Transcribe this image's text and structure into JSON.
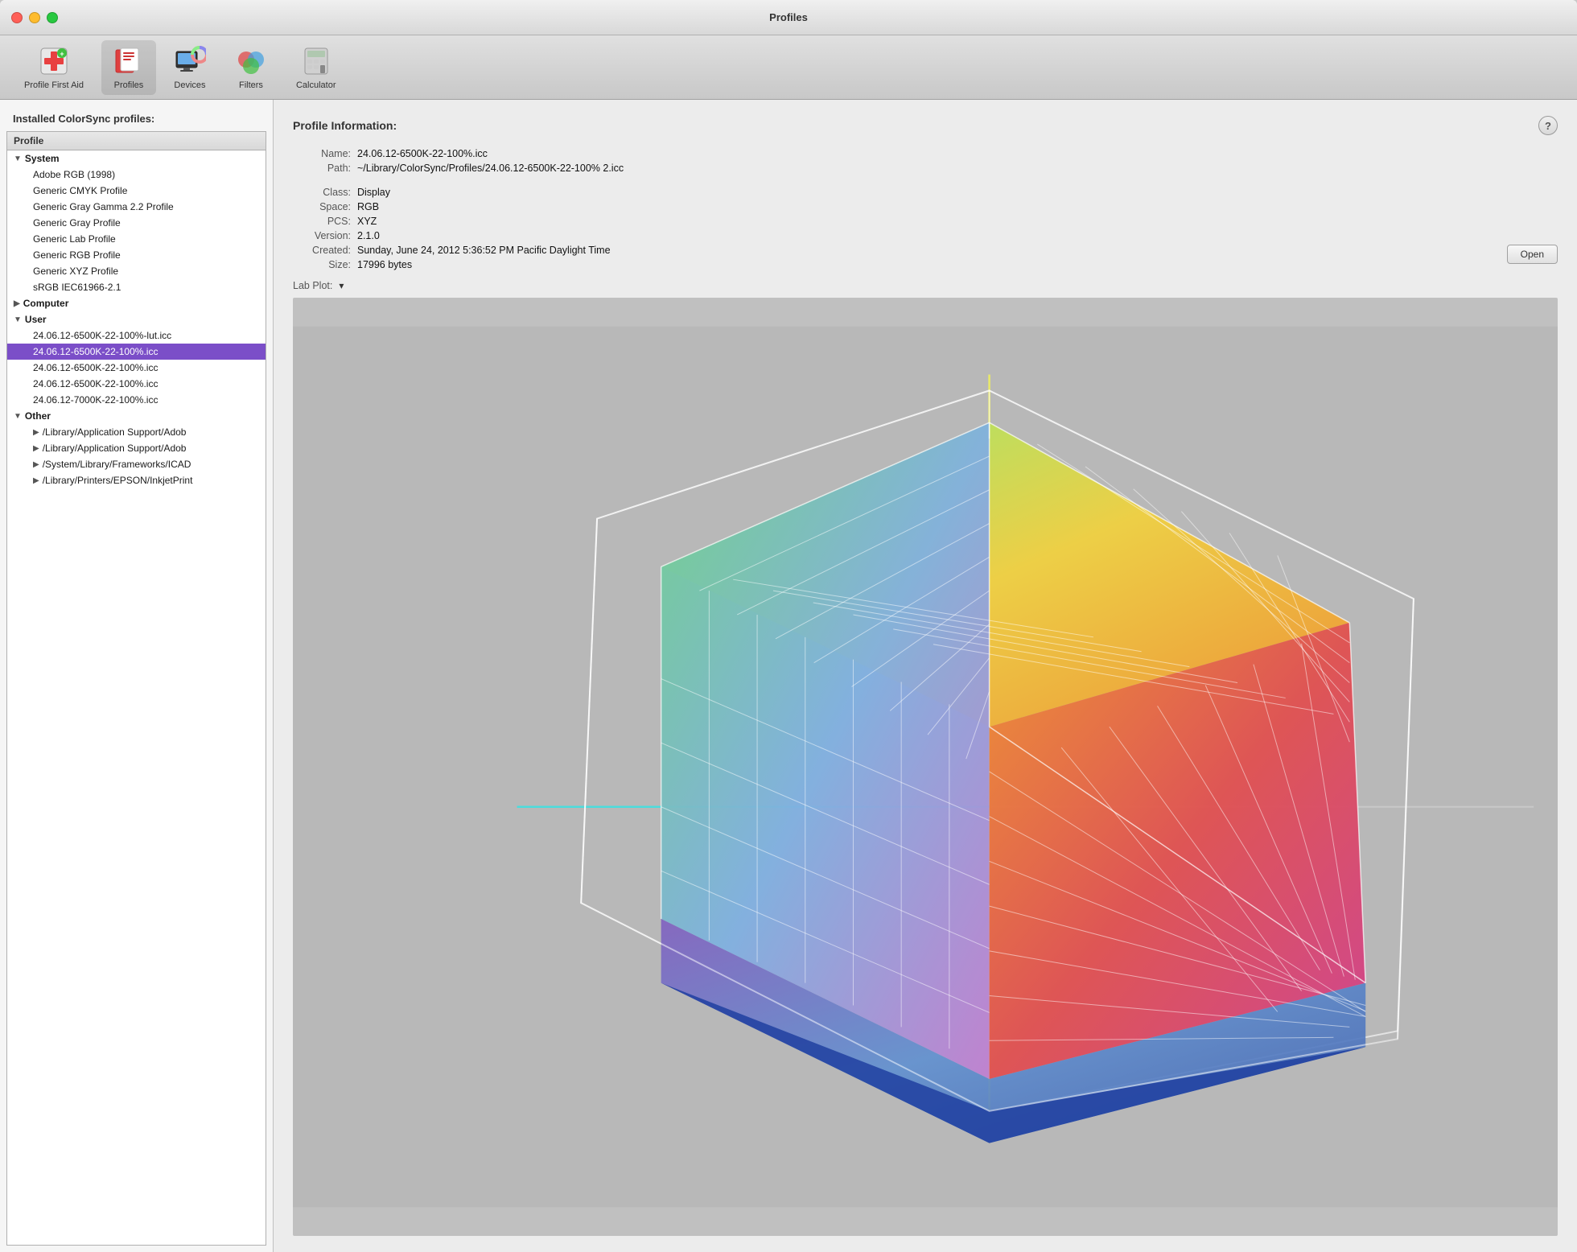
{
  "window": {
    "title": "Profiles"
  },
  "toolbar": {
    "items": [
      {
        "id": "profile-first-aid",
        "label": "Profile First Aid",
        "icon": "first-aid"
      },
      {
        "id": "profiles",
        "label": "Profiles",
        "icon": "profiles",
        "active": true
      },
      {
        "id": "devices",
        "label": "Devices",
        "icon": "devices"
      },
      {
        "id": "filters",
        "label": "Filters",
        "icon": "filters"
      },
      {
        "id": "calculator",
        "label": "Calculator",
        "icon": "calculator"
      }
    ]
  },
  "sidebar": {
    "header": "Installed ColorSync profiles:",
    "list_header": "Profile",
    "groups": [
      {
        "id": "system",
        "label": "System",
        "expanded": true,
        "items": [
          "Adobe RGB (1998)",
          "Generic CMYK Profile",
          "Generic Gray Gamma 2.2 Profile",
          "Generic Gray Profile",
          "Generic Lab Profile",
          "Generic RGB Profile",
          "Generic XYZ Profile",
          "sRGB IEC61966-2.1"
        ]
      },
      {
        "id": "computer",
        "label": "Computer",
        "expanded": false,
        "items": []
      },
      {
        "id": "user",
        "label": "User",
        "expanded": true,
        "items": [
          "24.06.12-6500K-22-100%-lut.icc",
          "24.06.12-6500K-22-100%.icc",
          "24.06.12-6500K-22-100%.icc",
          "24.06.12-6500K-22-100%.icc",
          "24.06.12-7000K-22-100%.icc"
        ],
        "selected_index": 1
      },
      {
        "id": "other",
        "label": "Other",
        "expanded": true,
        "items": [
          "/Library/Application Support/Adob",
          "/Library/Application Support/Adob",
          "/System/Library/Frameworks/ICAD",
          "/Library/Printers/EPSON/InkjetPrint"
        ]
      }
    ]
  },
  "profile_info": {
    "header": "Profile Information:",
    "open_btn": "Open",
    "fields": [
      {
        "label": "Name:",
        "value": "24.06.12-6500K-22-100%.icc"
      },
      {
        "label": "Path:",
        "value": "~/Library/ColorSync/Profiles/24.06.12-6500K-22-100% 2.icc"
      },
      {
        "label": "Class:",
        "value": "Display"
      },
      {
        "label": "Space:",
        "value": "RGB"
      },
      {
        "label": "PCS:",
        "value": "XYZ"
      },
      {
        "label": "Version:",
        "value": "2.1.0"
      },
      {
        "label": "Created:",
        "value": "Sunday, June 24, 2012 5:36:52 PM Pacific Daylight Time"
      },
      {
        "label": "Size:",
        "value": "17996 bytes"
      }
    ],
    "lab_plot_label": "Lab Plot:",
    "dropdown_arrow": "▾"
  },
  "traffic_lights": {
    "close": "close",
    "minimize": "minimize",
    "maximize": "maximize"
  }
}
